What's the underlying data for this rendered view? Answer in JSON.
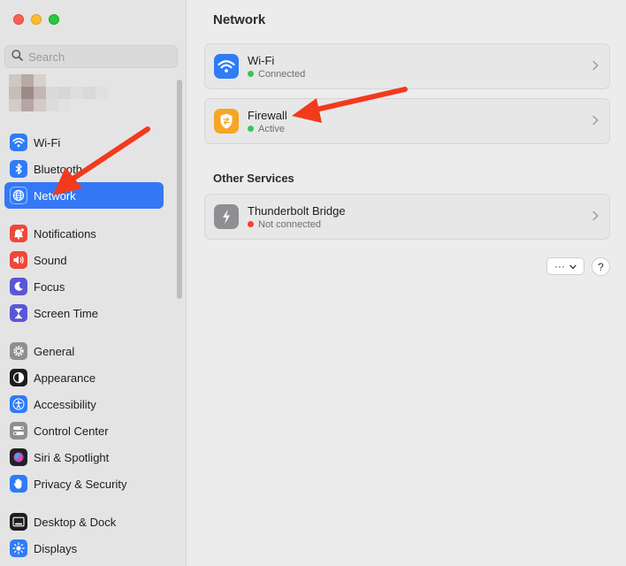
{
  "sidebar": {
    "search": {
      "placeholder": "Search"
    },
    "items": [
      {
        "label": "Wi-Fi",
        "icon": "wifi-icon",
        "color": "#2f7cf6"
      },
      {
        "label": "Bluetooth",
        "icon": "bluetooth-icon",
        "color": "#2f7cf6"
      },
      {
        "label": "Network",
        "icon": "globe-icon",
        "color": "#2f7cf6",
        "selected": true
      },
      {
        "label": "Notifications",
        "icon": "bell-icon",
        "color": "#f0473a"
      },
      {
        "label": "Sound",
        "icon": "speaker-icon",
        "color": "#f0473a"
      },
      {
        "label": "Focus",
        "icon": "moon-icon",
        "color": "#5b56d6"
      },
      {
        "label": "Screen Time",
        "icon": "hourglass-icon",
        "color": "#5b56d6"
      },
      {
        "label": "General",
        "icon": "gear-icon",
        "color": "#8e8e93"
      },
      {
        "label": "Appearance",
        "icon": "appearance-icon",
        "color": "#1d1d1f"
      },
      {
        "label": "Accessibility",
        "icon": "accessibility-icon",
        "color": "#2f7cf6"
      },
      {
        "label": "Control Center",
        "icon": "toggles-icon",
        "color": "#8e8e93"
      },
      {
        "label": "Siri & Spotlight",
        "icon": "siri-icon",
        "color": "#222222"
      },
      {
        "label": "Privacy & Security",
        "icon": "hand-icon",
        "color": "#2f7cf6"
      },
      {
        "label": "Desktop & Dock",
        "icon": "dock-icon",
        "color": "#1d1d1f"
      },
      {
        "label": "Displays",
        "icon": "sun-icon",
        "color": "#2f7cf6"
      }
    ]
  },
  "main": {
    "title": "Network",
    "services": [
      {
        "title": "Wi-Fi",
        "status": "Connected",
        "status_color": "#34c759",
        "icon": "wifi-icon",
        "icon_color": "#2f7cf6"
      },
      {
        "title": "Firewall",
        "status": "Active",
        "status_color": "#34c759",
        "icon": "firewall-icon",
        "icon_color": "#f5a623"
      }
    ],
    "other_title": "Other Services",
    "other_services": [
      {
        "title": "Thunderbolt Bridge",
        "status": "Not connected",
        "status_color": "#ff3b30",
        "icon": "thunderbolt-icon",
        "icon_color": "#8e8e93"
      }
    ],
    "more_button": "···",
    "help_button": "?"
  },
  "colors": {
    "accent": "#3478f6",
    "annotation_arrow": "#f23a1d"
  }
}
